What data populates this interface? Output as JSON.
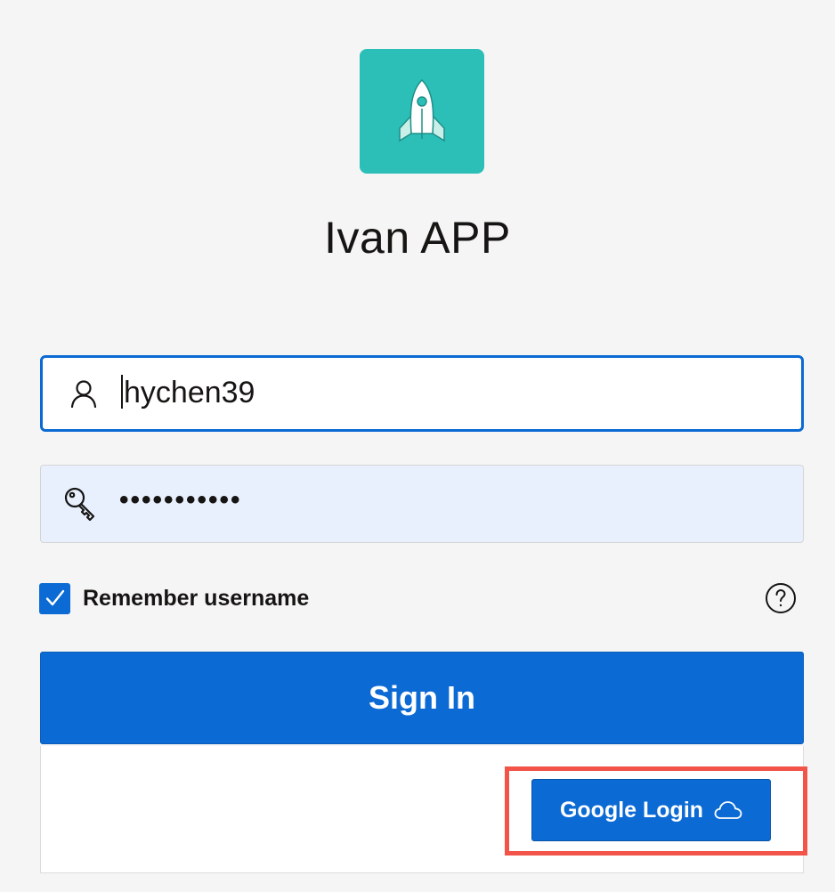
{
  "app": {
    "title": "Ivan APP",
    "logo_icon": "rocket-icon",
    "logo_color": "#2bbfb8"
  },
  "login_form": {
    "username": {
      "icon": "user-icon",
      "value": "hychen39"
    },
    "password": {
      "icon": "key-icon",
      "masked_value": "•••••••••••"
    },
    "remember": {
      "checked": true,
      "label": "Remember username"
    },
    "help_icon": "question-circle-icon",
    "sign_in_label": "Sign In"
  },
  "alternate_login": {
    "google_label": "Google Login",
    "google_icon": "cloud-icon",
    "highlight_color": "#f2544a"
  },
  "colors": {
    "accent": "#0b6ad3",
    "background": "#f5f5f5",
    "autofill": "#e8f0fe"
  }
}
